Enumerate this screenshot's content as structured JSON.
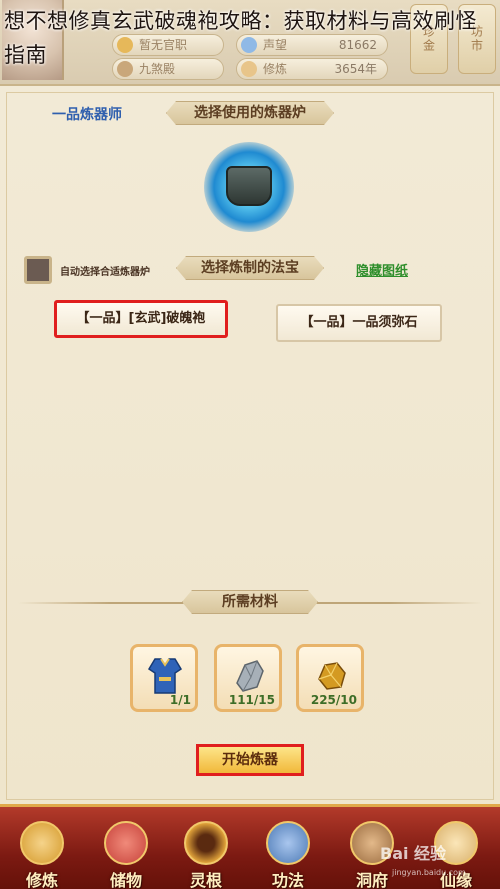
{
  "article_title": "想不想修真玄武破魂袍攻略：获取材料与高效刷怪指南",
  "header": {
    "stats": [
      {
        "label": "暂无官职",
        "value": ""
      },
      {
        "label": "声望",
        "value": "81662"
      },
      {
        "label": "九煞殿",
        "value": ""
      },
      {
        "label": "修炼",
        "value": "3654年"
      }
    ],
    "side_tags": [
      "珍金",
      "坊市"
    ]
  },
  "crafting": {
    "rank": "一品炼器师",
    "furnace_banner": "选择使用的炼器炉",
    "auto_select_label": "自动选择合适炼器炉",
    "artifact_banner": "选择炼制的法宝",
    "hide_recipe_link": "隐藏图纸",
    "items": [
      {
        "label": "【一品】[玄武]破魄袍",
        "selected": true
      },
      {
        "label": "【一品】一品须弥石",
        "selected": false
      }
    ],
    "materials_banner": "所需材料",
    "materials": [
      {
        "icon": "robe-icon",
        "count": "1/1",
        "color": "#2f63b8"
      },
      {
        "icon": "stone-icon",
        "count": "111/15",
        "color": "#a7b0b8"
      },
      {
        "icon": "ore-icon",
        "count": "225/10",
        "color": "#d49a22"
      }
    ],
    "start_button": "开始炼器"
  },
  "bottom_nav": [
    {
      "label": "修炼",
      "icon": "meditation-icon",
      "color": "#d59a2b"
    },
    {
      "label": "储物",
      "icon": "bag-icon",
      "color": "#c7423a"
    },
    {
      "label": "灵根",
      "icon": "spirit-root-icon",
      "color": "#e1a33a"
    },
    {
      "label": "功法",
      "icon": "scroll-icon",
      "color": "#4c79b4"
    },
    {
      "label": "洞府",
      "icon": "cave-icon",
      "color": "#9a6b3f"
    },
    {
      "label": "仙缘",
      "icon": "fate-icon",
      "color": "#d9b06a"
    }
  ],
  "watermark": {
    "text": "Bai 经验",
    "sub": "jingyan.baidu.com"
  }
}
